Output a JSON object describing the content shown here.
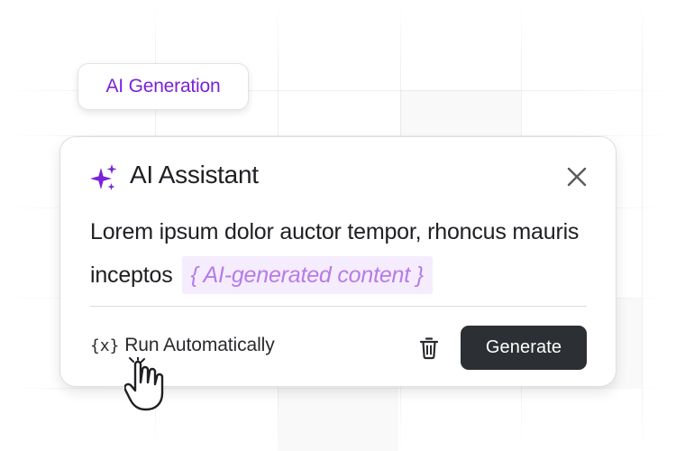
{
  "chip": {
    "label": "AI Generation"
  },
  "assistant": {
    "title": "AI Assistant",
    "body_text": "Lorem ipsum dolor auctor tempor, rhoncus mauris inceptos",
    "ai_token": "{ AI-generated content }",
    "run_label": "Run Automatically",
    "var_glyph": "{x}",
    "generate_label": "Generate"
  },
  "colors": {
    "accent": "#7a22d8",
    "token_bg": "#f5ecfd",
    "token_text": "#b57ce8",
    "button_bg": "#2c2f33"
  },
  "icons": [
    "sparkle-icon",
    "close-icon",
    "variable-icon",
    "trash-icon",
    "hand-cursor-icon"
  ]
}
